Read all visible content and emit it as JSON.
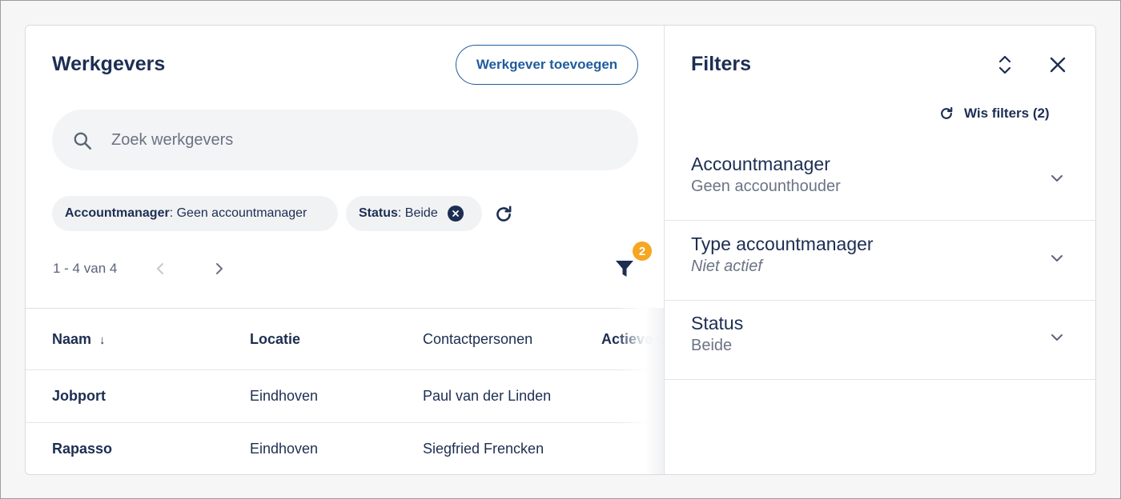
{
  "main": {
    "title": "Werkgevers",
    "add_button": "Werkgever toevoegen",
    "search_placeholder": "Zoek werkgevers",
    "chips": [
      {
        "key": "Accountmanager",
        "value": ": Geen accountmanager"
      },
      {
        "key": "Status",
        "value": ": Beide"
      }
    ],
    "pagination": "1 - 4 van 4",
    "filter_badge": "2",
    "table": {
      "headers": [
        "Naam",
        "Locatie",
        "Contactpersonen",
        "Actieve v"
      ],
      "rows": [
        [
          "Jobport",
          "Eindhoven",
          "Paul van der Linden"
        ],
        [
          "Rapasso",
          "Eindhoven",
          "Siegfried Frencken"
        ]
      ]
    }
  },
  "filters": {
    "title": "Filters",
    "clear_label": "Wis filters (2)",
    "items": [
      {
        "name": "Accountmanager",
        "value": "Geen accounthouder"
      },
      {
        "name": "Type accountmanager",
        "value": "Niet actief"
      },
      {
        "name": "Status",
        "value": "Beide"
      }
    ]
  },
  "colors": {
    "primary": "#1c2e52",
    "accent": "#1f5c9c",
    "badge": "#f5a623"
  }
}
